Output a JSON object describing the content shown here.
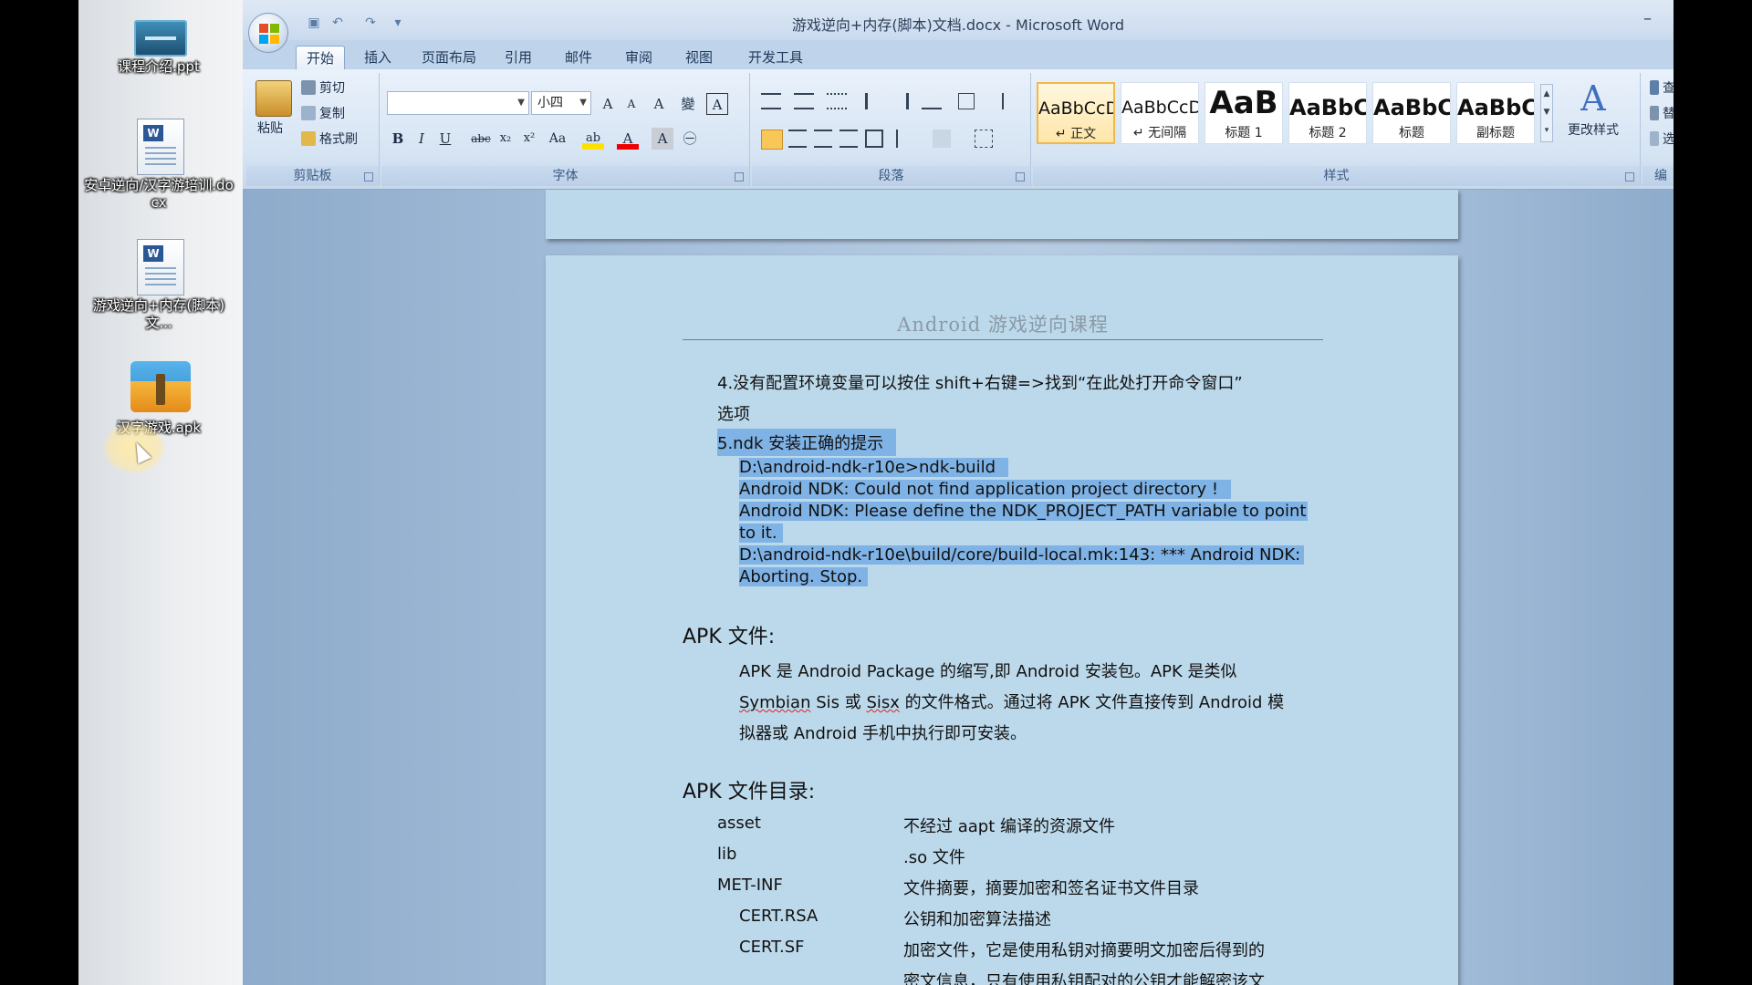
{
  "desktop": {
    "icons": [
      {
        "label": "课程介绍.ppt"
      },
      {
        "label": "安卓逆向/汉字游培训.docx"
      },
      {
        "label": "游戏逆向+内存(脚本)文..."
      },
      {
        "label": "汉字游戏.apk"
      }
    ]
  },
  "window": {
    "title": "游戏逆向+内存(脚本)文档.docx - Microsoft Word",
    "minimize_glyph": "–",
    "quick_access": {
      "save": "▣",
      "undo": "↶",
      "redo": "↷",
      "more": "▾"
    },
    "tabs": [
      {
        "label": "开始"
      },
      {
        "label": "插入"
      },
      {
        "label": "页面布局"
      },
      {
        "label": "引用"
      },
      {
        "label": "邮件"
      },
      {
        "label": "审阅"
      },
      {
        "label": "视图"
      },
      {
        "label": "开发工具"
      }
    ]
  },
  "ribbon": {
    "clipboard": {
      "paste": "粘贴",
      "cut": "剪切",
      "copy": "复制",
      "format_painter": "格式刷",
      "group": "剪贴板"
    },
    "font": {
      "font_name": "",
      "font_size": "小四",
      "group": "字体",
      "grow": "A",
      "shrink": "A",
      "clear": "A",
      "pinyin": "變",
      "border_char": "A",
      "bold": "B",
      "italic": "I",
      "underline": "U",
      "strike": "abc",
      "sub": "x₂",
      "sup": "x²",
      "case": "Aa",
      "highlight": "ab",
      "color": "A",
      "shade": "A",
      "enclose": "㊀"
    },
    "paragraph": {
      "group": "段落"
    },
    "styles": {
      "group": "样式",
      "change": "更改样式",
      "items": [
        {
          "sample": "AaBbCcD",
          "name": "↵ 正文"
        },
        {
          "sample": "AaBbCcD",
          "name": "↵ 无间隔"
        },
        {
          "sample": "AaB",
          "name": "标题 1"
        },
        {
          "sample": "AaBbC",
          "name": "标题 2"
        },
        {
          "sample": "AaBbC",
          "name": "标题"
        },
        {
          "sample": "AaBbC",
          "name": "副标题"
        }
      ]
    },
    "editing": {
      "find": "查",
      "replace": "替",
      "select": "选",
      "group": "编"
    }
  },
  "document": {
    "header": "Android 游戏逆向课程",
    "item4_line1": "4.没有配置环境变量可以按住 shift+右键=>找到“在此处打开命令窗口”",
    "item4_line2": "选项",
    "item5": "5.ndk 安装正确的提示",
    "code": [
      "D:\\android-ndk-r10e>ndk-build",
      "Android NDK: Could not find application project directory !",
      "Android NDK: Please define the NDK_PROJECT_PATH variable to point",
      "to it.",
      "D:\\android-ndk-r10e\\build/core/build-local.mk:143: *** Android NDK:",
      "Aborting.  Stop."
    ],
    "apk_heading": "APK 文件:",
    "apk_desc_1": "APK 是 Android Package 的缩写,即 Android 安装包。APK 是类似",
    "apk_desc_2a": "Symbian",
    "apk_desc_2b": " Sis 或 ",
    "apk_desc_2c": "Sisx",
    "apk_desc_2d": " 的文件格式。通过将 APK 文件直接传到 Android 模",
    "apk_desc_3": "拟器或 Android 手机中执行即可安装。",
    "dir_heading": "APK 文件目录:",
    "dir_rows": [
      {
        "name": "asset",
        "desc": "不经过 aapt 编译的资源文件"
      },
      {
        "name": "lib",
        "desc": ".so 文件"
      },
      {
        "name": "MET-INF",
        "desc": "文件摘要，摘要加密和签名证书文件目录"
      },
      {
        "name": "CERT.RSA",
        "desc": "公钥和加密算法描述"
      },
      {
        "name": "CERT.SF",
        "desc": "加密文件，它是使用私钥对摘要明文加密后得到的"
      }
    ],
    "dir_last_line": "密文信息，只有使用私钥配对的公钥才能解密该文"
  }
}
